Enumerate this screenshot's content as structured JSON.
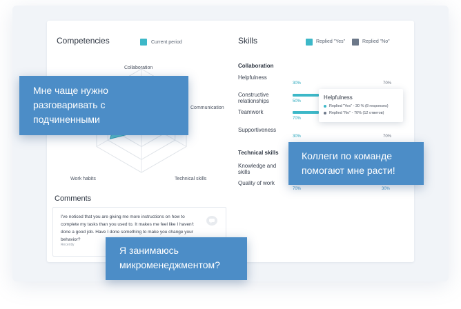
{
  "competencies": {
    "title": "Competencies",
    "legend": {
      "label": "Current period",
      "color": "#3db8c8"
    },
    "axes": [
      "Collaboration",
      "Communication",
      "Technical skills",
      "Work habits"
    ],
    "radar_levels": 4
  },
  "skills": {
    "title": "Skills",
    "legend": [
      {
        "label": "Replied \"Yes\"",
        "color": "#3db8c8"
      },
      {
        "label": "Replied \"No\"",
        "color": "#6c7889"
      }
    ],
    "groups": [
      {
        "name": "Collaboration",
        "items": [
          {
            "label": "Helpfulness",
            "yes_pct": 30,
            "no_pct": 70,
            "yes_label": "30%",
            "no_label": "70%"
          },
          {
            "label": "Constructive relationships",
            "yes_pct": 50,
            "no_pct": 50,
            "yes_label": "50%",
            "no_label": ""
          },
          {
            "label": "Teamwork",
            "yes_pct": 70,
            "no_pct": 30,
            "yes_label": "70%",
            "no_label": ""
          },
          {
            "label": "Supportiveness",
            "yes_pct": 30,
            "no_pct": 70,
            "yes_label": "30%",
            "no_label": "70%"
          }
        ]
      },
      {
        "name": "Technical skills",
        "items": [
          {
            "label": "Knowledge and skills",
            "yes_pct": 0,
            "no_pct": 0,
            "yes_label": "",
            "no_label": ""
          },
          {
            "label": "Quality of work",
            "yes_pct": 70,
            "no_pct": 30,
            "yes_label": "70%",
            "no_label": "30%"
          }
        ]
      }
    ],
    "tooltip": {
      "title": "Helpfulness",
      "yes_line": "Replied \"Yes\" - 30 % (8 responses)",
      "no_line": "Replied \"No\" - 70% (12 ответов)"
    }
  },
  "comments": {
    "title": "Comments",
    "items": [
      {
        "text": "I've noticed that you are giving me more instructions on how to complete my tasks than you used to. It makes me feel like I haven't done a good job. Have I done something to make you change your behavior?",
        "time": "Recently"
      }
    ]
  },
  "callouts": {
    "left": [
      "Мне чаще нужно",
      "разговаривать с",
      "подчиненными"
    ],
    "right": [
      "Коллеги по команде",
      "помогают мне расти!"
    ],
    "bottom": [
      "Я занимаюсь",
      "микроменеджментом?"
    ]
  },
  "colors": {
    "accent": "#3db8c8",
    "accent_dark": "#2a9db0",
    "no": "#6c7889",
    "callout": "#4c8dc7"
  }
}
